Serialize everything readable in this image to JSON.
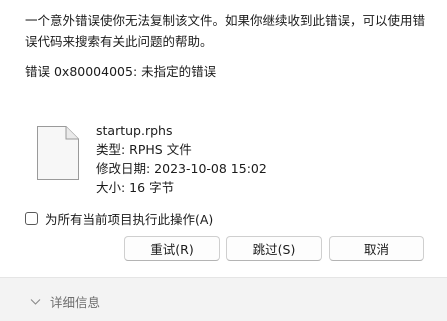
{
  "message": {
    "line1": "一个意外错误使你无法复制该文件。如果你继续收到此错误，可以使用错",
    "line2": "误代码来搜索有关此问题的帮助。"
  },
  "error_text": "错误 0x80004005: 未指定的错误",
  "file": {
    "icon": "file-icon",
    "name": "startup.rphs",
    "type": "类型: RPHS 文件",
    "modified": "修改日期: 2023-10-08 15:02",
    "size": "大小: 16 字节"
  },
  "apply_all": {
    "label": "为所有当前项目执行此操作(A)",
    "checked": false
  },
  "buttons": {
    "retry": "重试(R)",
    "skip": "跳过(S)",
    "cancel": "取消"
  },
  "footer": {
    "details_label": "详细信息",
    "details_icon": "chevron-down-icon"
  }
}
